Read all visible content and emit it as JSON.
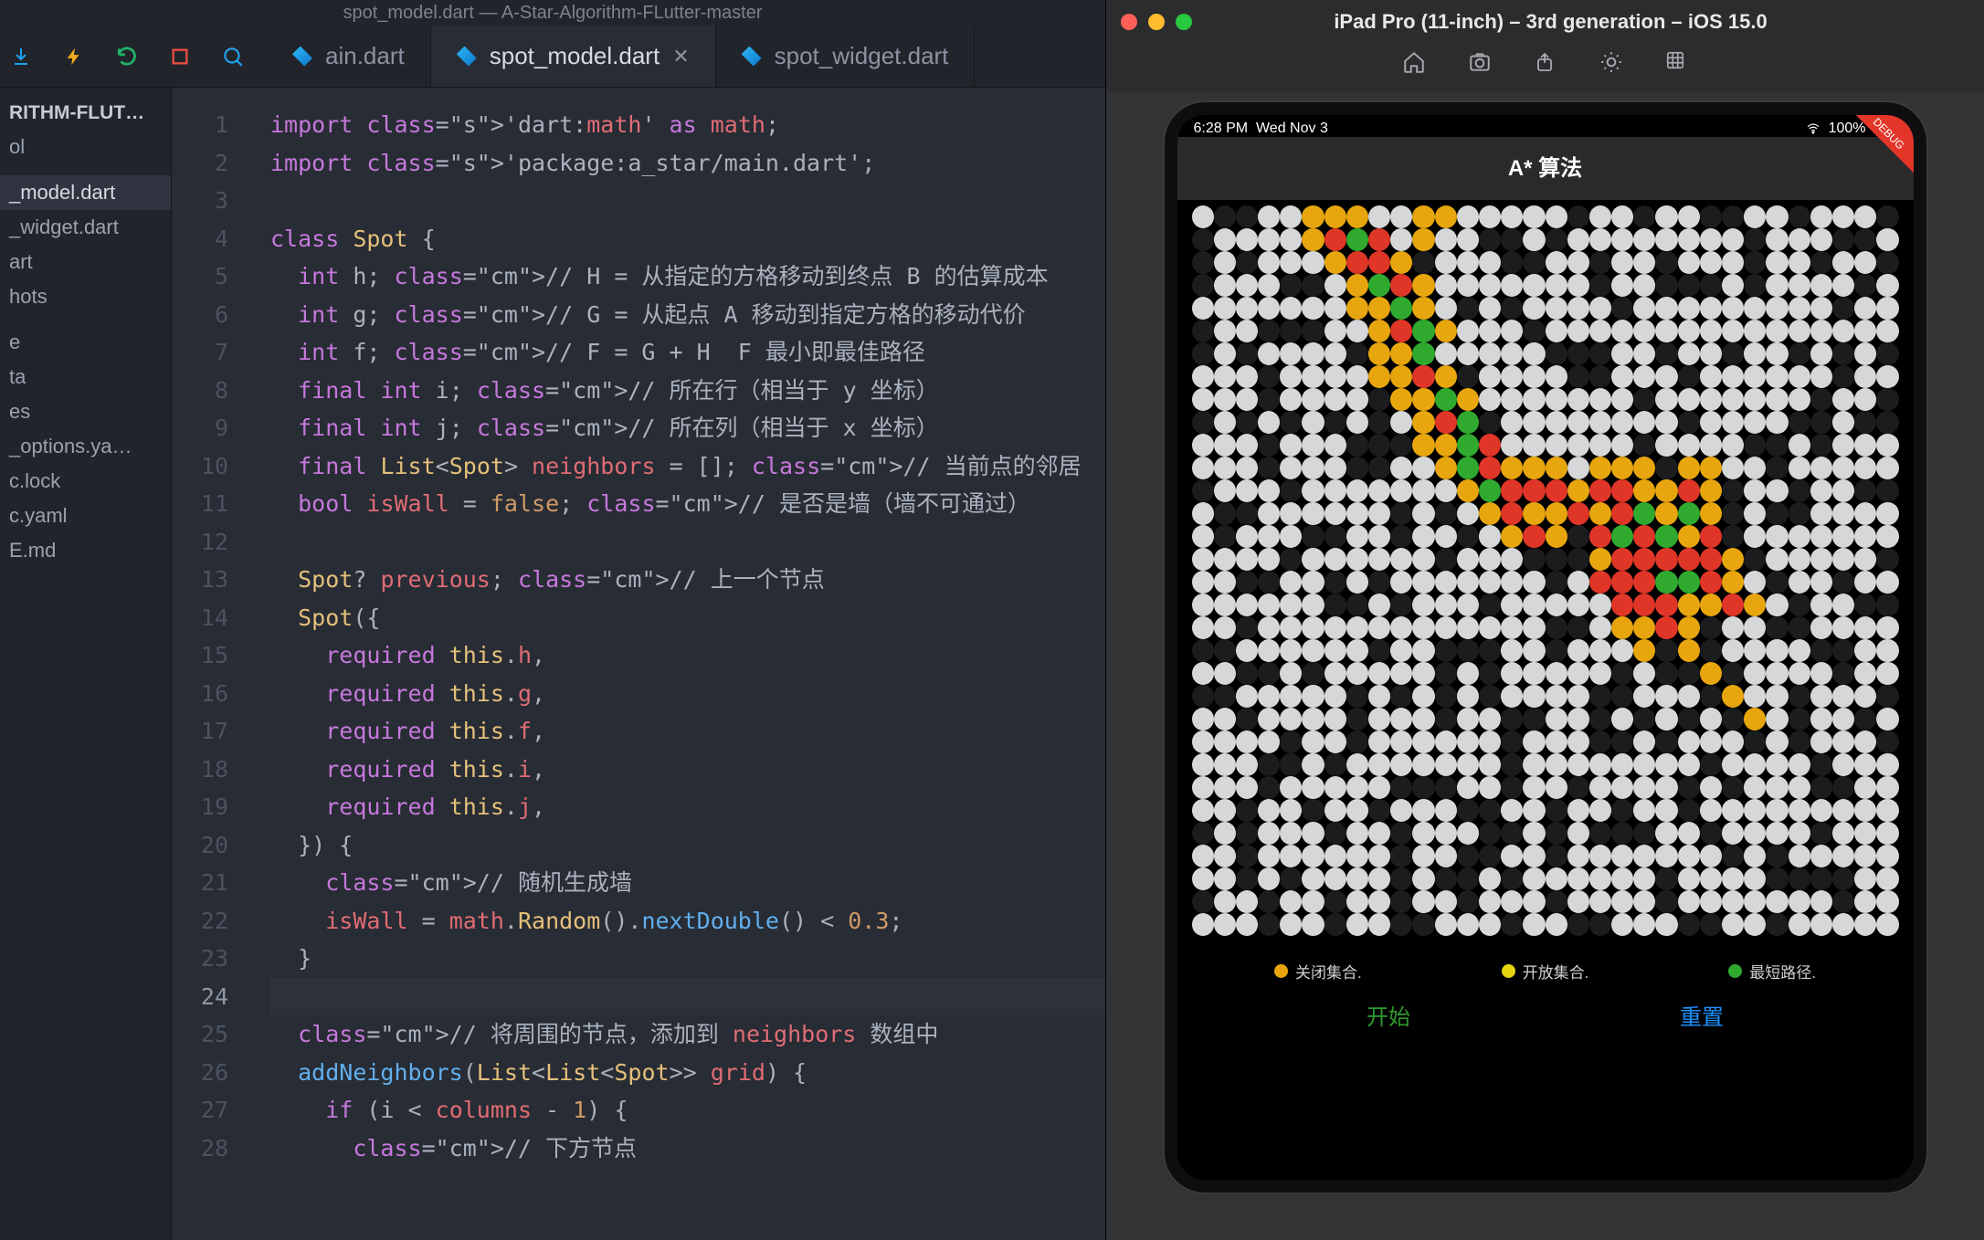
{
  "window_title": "spot_model.dart — A-Star-Algorithm-FLutter-master",
  "toolbar_icons": [
    "download-icon",
    "lightning-icon",
    "undo-icon",
    "stop-icon",
    "inspect-icon"
  ],
  "tabs": [
    {
      "label": "ain.dart",
      "active": false,
      "closeable": false
    },
    {
      "label": "spot_model.dart",
      "active": true,
      "closeable": true
    },
    {
      "label": "spot_widget.dart",
      "active": false,
      "closeable": false
    }
  ],
  "sidebar_heading": "RITHM-FLUT…",
  "sidebar_items": [
    "ol",
    "",
    "_model.dart",
    "_widget.dart",
    "art",
    "hots",
    "",
    "e",
    "ta",
    "es",
    "_options.ya…",
    "c.lock",
    "c.yaml",
    "E.md"
  ],
  "sidebar_selected": "_model.dart",
  "code_lines": [
    "import 'dart:math' as math;",
    "import 'package:a_star/main.dart';",
    "",
    "class Spot {",
    "  int h; // H = 从指定的方格移动到终点 B 的估算成本",
    "  int g; // G = 从起点 A 移动到指定方格的移动代价",
    "  int f; // F = G + H  F 最小即最佳路径",
    "  final int i; // 所在行（相当于 y 坐标）",
    "  final int j; // 所在列（相当于 x 坐标）",
    "  final List<Spot> neighbors = []; // 当前点的邻居",
    "  bool isWall = false; // 是否是墙（墙不可通过）",
    "",
    "  Spot? previous; // 上一个节点",
    "  Spot({",
    "    required this.h,",
    "    required this.g,",
    "    required this.f,",
    "    required this.i,",
    "    required this.j,",
    "  }) {",
    "    // 随机生成墙",
    "    isWall = math.Random().nextDouble() < 0.3;",
    "  }",
    "",
    "  // 将周围的节点，添加到 neighbors 数组中",
    "  addNeighbors(List<List<Spot>> grid) {",
    "    if (i < columns - 1) {",
    "      // 下方节点"
  ],
  "first_line_no": 1,
  "current_line": 24,
  "simulator": {
    "title": "iPad Pro (11-inch) – 3rd generation – iOS 15.0",
    "status": {
      "time": "6:28 PM",
      "date": "Wed Nov 3",
      "battery": "100%"
    },
    "app_title": "A* 算法",
    "legend": [
      {
        "color": "orange",
        "label": "关闭集合."
      },
      {
        "color": "yellow",
        "label": "开放集合."
      },
      {
        "color": "green",
        "label": "最短路径."
      }
    ],
    "buttons": {
      "start": "开始",
      "reset": "重置"
    },
    "debug_badge": "DEBUG"
  },
  "grid_legend": {
    "0": "empty",
    "1": "wall",
    "2": "open",
    "3": "closed",
    "4": "path"
  },
  "grid": [
    "01100222002200000100100110010001",
    "10000234302001101000000001000110",
    "10100023321000110010010001001001",
    "10001102432000000010011101000010",
    "00000002242010100001000000000100",
    "10011100234200010000000000000000",
    "10100001224000001110010010010101",
    "00010000223210000110001000000100",
    "00010000122420000000100000001001",
    "10101010102341000000001000011011",
    "00010001112243000000100001101000",
    "00010001100243222022212200100000",
    "10001000000024333233223210010011",
    "01100000010102322323424210110000",
    "01000110010010232134342310000000",
    "00001000000100011123333321000001",
    "00110010100000001033344320100100",
    "00000011010001000003332232010011",
    "00100000000000001102232100110000",
    "11000000100111001000212100001100",
    "00110100000101000001011210000100",
    "11000001010101000011000120010001",
    "00100001000100110010101012010010",
    "00001001000000100011010001010001",
    "00011010000000100000000100001000",
    "00010000011100100100001010001100",
    "00100100100011001001001000000000",
    "10100010010001101011100100001000",
    "00100000010011001000000010100000",
    "00101000010110100000010000111100",
    "10010010010010001000010000000100",
    "00010010011000100110001100100000"
  ]
}
